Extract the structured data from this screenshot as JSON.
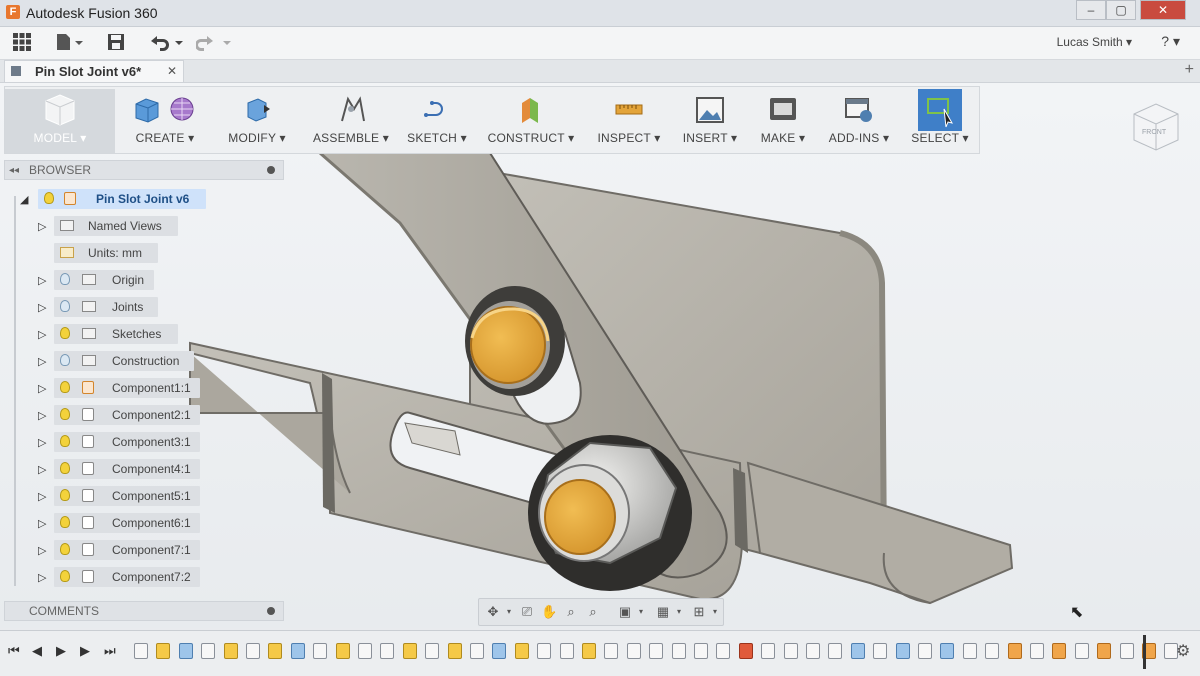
{
  "titlebar": {
    "app_title": "Autodesk Fusion 360",
    "logo_letter": "F",
    "minimize": "–",
    "maximize": "▢",
    "close": "✕"
  },
  "topbar": {
    "user_name": "Lucas Smith ▾",
    "help": "? ▾"
  },
  "tab": {
    "label": "Pin Slot Joint v6*",
    "close": "✕",
    "add": "+"
  },
  "toolbar": {
    "workspace": "MODEL ▾",
    "groups": [
      "CREATE ▾",
      "MODIFY ▾",
      "ASSEMBLE ▾",
      "SKETCH ▾",
      "CONSTRUCT ▾",
      "INSPECT ▾",
      "INSERT ▾",
      "MAKE ▾",
      "ADD-INS ▾",
      "SELECT ▾"
    ]
  },
  "browser": {
    "title": "BROWSER",
    "root": "Pin Slot Joint v6",
    "items": [
      {
        "label": "Named Views"
      },
      {
        "label": "Units: mm"
      },
      {
        "label": "Origin"
      },
      {
        "label": "Joints"
      },
      {
        "label": "Sketches"
      },
      {
        "label": "Construction"
      },
      {
        "label": "Component1:1"
      },
      {
        "label": "Component2:1"
      },
      {
        "label": "Component3:1"
      },
      {
        "label": "Component4:1"
      },
      {
        "label": "Component5:1"
      },
      {
        "label": "Component6:1"
      },
      {
        "label": "Component7:1"
      },
      {
        "label": "Component7:2"
      }
    ]
  },
  "comments": {
    "title": "COMMENTS"
  },
  "colors": {
    "accent": "#3f7fc8",
    "pin_orange": "#e3a43a",
    "part_gray": "#b4b1a8",
    "bulb_yellow": "#f3d23b"
  },
  "icons": {
    "workspace": "model-cube-icon",
    "orbit": "orbit-icon",
    "pan": "hand-pan-icon",
    "zoom": "zoom-icon",
    "display": "display-settings-icon",
    "grid": "grid-icon"
  }
}
